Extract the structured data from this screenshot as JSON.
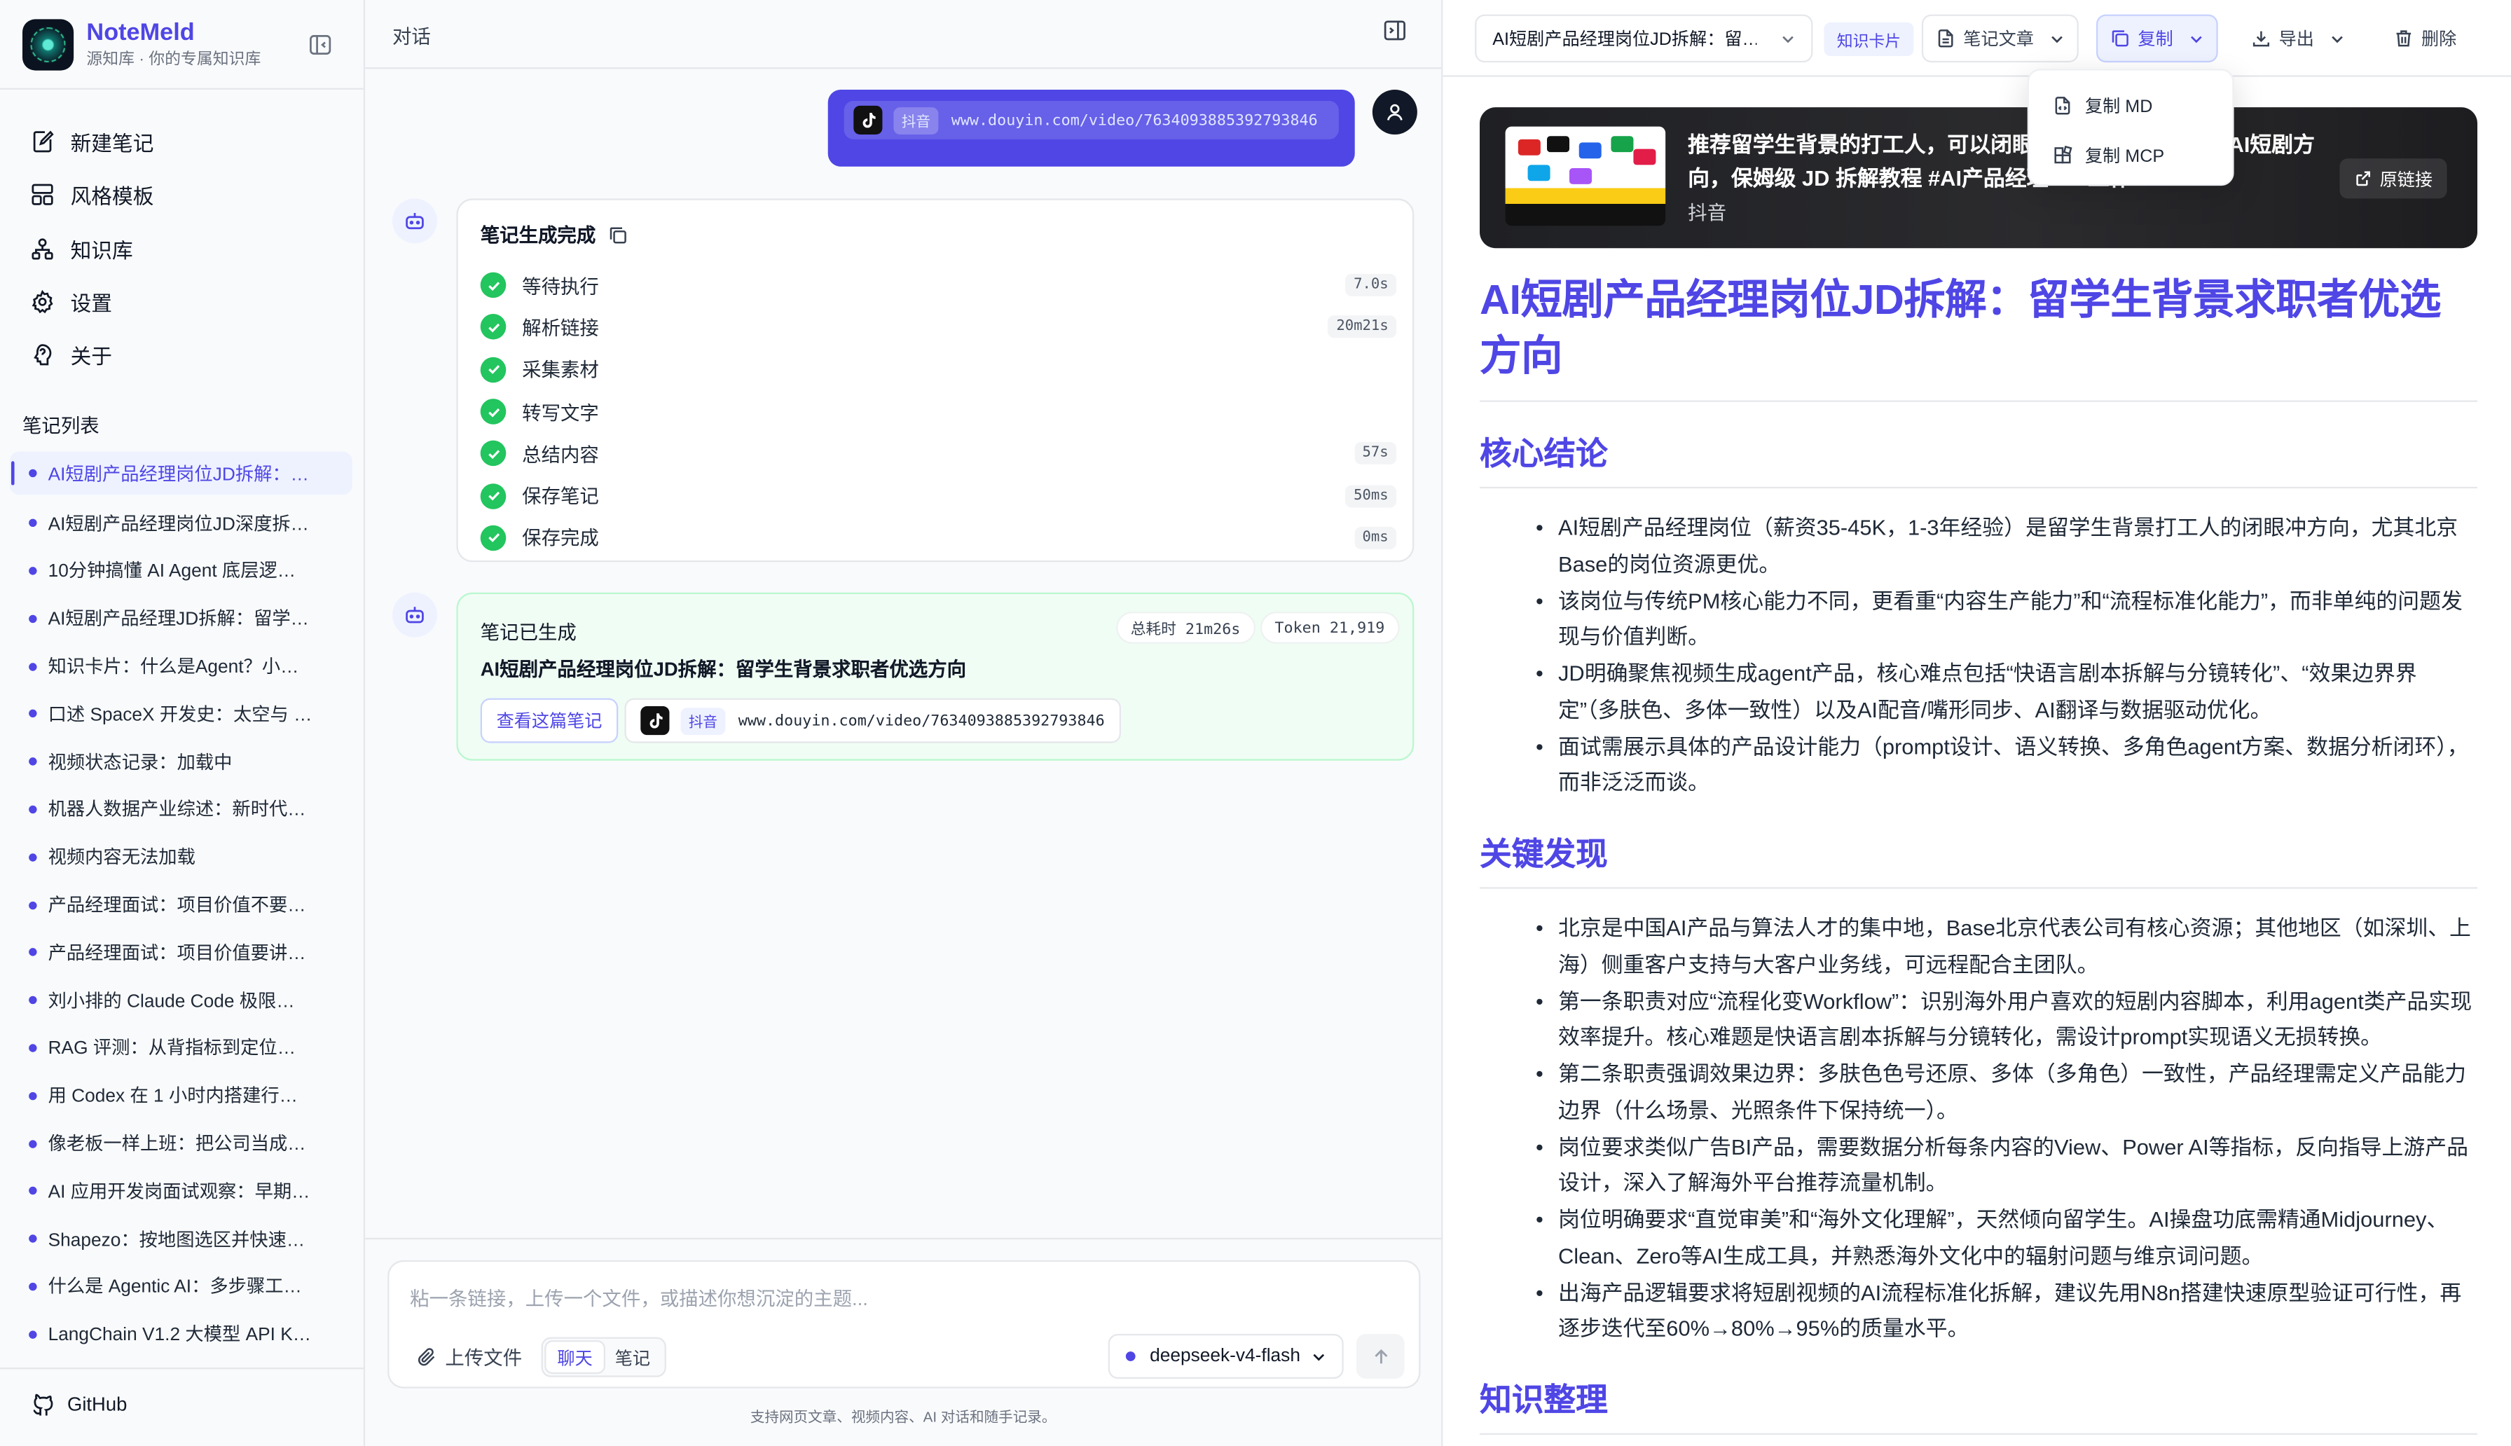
{
  "app": {
    "name": "NoteMeld",
    "subtitle": "源知库 · 你的专属知识库",
    "accent": "#4f46e5"
  },
  "sidebar": {
    "nav": [
      {
        "label": "新建笔记",
        "icon": "new-note-icon"
      },
      {
        "label": "风格模板",
        "icon": "template-icon"
      },
      {
        "label": "知识库",
        "icon": "knowledge-base-icon"
      },
      {
        "label": "设置",
        "icon": "gear-icon"
      },
      {
        "label": "关于",
        "icon": "info-icon"
      }
    ],
    "notes_header": "笔记列表",
    "notes": [
      "AI短剧产品经理岗位JD拆解：…",
      "AI短剧产品经理岗位JD深度拆…",
      "10分钟搞懂 AI Agent 底层逻…",
      "AI短剧产品经理JD拆解：留学…",
      "知识卡片：什么是Agent？小…",
      "口述 SpaceX 开发史：太空与 …",
      "视频状态记录：加载中",
      "机器人数据产业综述：新时代…",
      "视频内容无法加载",
      "产品经理面试：项目价值不要…",
      "产品经理面试：项目价值要讲…",
      "刘小排的 Claude Code 极限…",
      "RAG 评测：从背指标到定位系…",
      "用 Codex 在 1 小时内搭建行…",
      "像老板一样上班：把公司当成…",
      "AI 应用开发岗面试观察：早期…",
      "Shapezo：按地图选区并快速…",
      "什么是 Agentic AI：多步骤工…",
      "LangChain V1.2 大模型 API K…"
    ],
    "github_label": "GitHub"
  },
  "chat": {
    "title": "对话",
    "user_message": {
      "platform": "抖音",
      "url": "www.douyin.com/video/7634093885392793846"
    },
    "progress_card": {
      "title": "笔记生成完成",
      "steps": [
        {
          "label": "等待执行",
          "duration": "7.0s"
        },
        {
          "label": "解析链接",
          "duration": "20m21s"
        },
        {
          "label": "采集素材",
          "duration": ""
        },
        {
          "label": "转写文字",
          "duration": ""
        },
        {
          "label": "总结内容",
          "duration": "57s"
        },
        {
          "label": "保存笔记",
          "duration": "50ms"
        },
        {
          "label": "保存完成",
          "duration": "0ms"
        }
      ]
    },
    "result_card": {
      "title": "笔记已生成",
      "note_title": "AI短剧产品经理岗位JD拆解：留学生背景求职者优选方向",
      "total_time": "总耗时 21m26s",
      "tokens": "Token 21,919",
      "view_button": "查看这篇笔记",
      "platform": "抖音",
      "url": "www.douyin.com/video/7634093885392793846"
    },
    "composer": {
      "placeholder": "粘一条链接，上传一个文件，或描述你想沉淀的主题...",
      "upload_label": "上传文件",
      "modes": [
        "聊天",
        "笔记"
      ],
      "active_mode": "聊天",
      "model": "deepseek-v4-flash",
      "hint": "支持网页文章、视频内容、AI 对话和随手记录。"
    }
  },
  "note": {
    "toolbar": {
      "select_value": "AI短剧产品经理岗位JD拆解：留…",
      "badge": "知识卡片",
      "type_label": "笔记文章",
      "copy_label": "复制",
      "export_label": "导出",
      "delete_label": "删除"
    },
    "copy_menu": [
      "复制 MD",
      "复制 MCP"
    ],
    "video": {
      "title": "推荐留学生背景的打工人，可以闭眼冲一个北京的岗位，AI短剧方向，保姆级 JD 拆解教程 #AI产品经理 #AI工作 #…",
      "source": "抖音",
      "link_label": "原链接"
    },
    "title": "AI短剧产品经理岗位JD拆解：留学生背景求职者优选方向",
    "sections": [
      {
        "heading": "核心结论",
        "items": [
          "AI短剧产品经理岗位（薪资35-45K，1-3年经验）是留学生背景打工人的闭眼冲方向，尤其北京Base的岗位资源更优。",
          "该岗位与传统PM核心能力不同，更看重“内容生产能力”和“流程标准化能力”，而非单纯的问题发现与价值判断。",
          "JD明确聚焦视频生成agent产品，核心难点包括“快语言剧本拆解与分镜转化”、“效果边界界定”（多肤色、多体一致性）以及AI配音/嘴形同步、AI翻译与数据驱动优化。",
          "面试需展示具体的产品设计能力（prompt设计、语义转换、多角色agent方案、数据分析闭环），而非泛泛而谈。"
        ]
      },
      {
        "heading": "关键发现",
        "items": [
          "北京是中国AI产品与算法人才的集中地，Base北京代表公司有核心资源；其他地区（如深圳、上海）侧重客户支持与大客户业务线，可远程配合主团队。",
          "第一条职责对应“流程化变Workflow”：识别海外用户喜欢的短剧内容脚本，利用agent类产品实现效率提升。核心难题是快语言剧本拆解与分镜转化，需设计prompt实现语义无损转换。",
          "第二条职责强调效果边界：多肤色色号还原、多体（多角色）一致性，产品经理需定义产品能力边界（什么场景、光照条件下保持统一）。",
          "岗位要求类似广告BI产品，需要数据分析每条内容的View、Power AI等指标，反向指导上游产品设计，深入了解海外平台推荐流量机制。",
          "岗位明确要求“直觉审美”和“海外文化理解”，天然倾向留学生。AI操盘功底需精通Midjourney、Clean、Zero等AI生成工具，并熟悉海外文化中的辐射问题与维京词问题。",
          "出海产品逻辑要求将短剧视频的AI流程标准化拆解，建议先用N8n搭建快速原型验证可行性，再逐步迭代至60%→80%→95%的质量水平。"
        ]
      },
      {
        "heading": "知识整理",
        "items": []
      }
    ]
  }
}
